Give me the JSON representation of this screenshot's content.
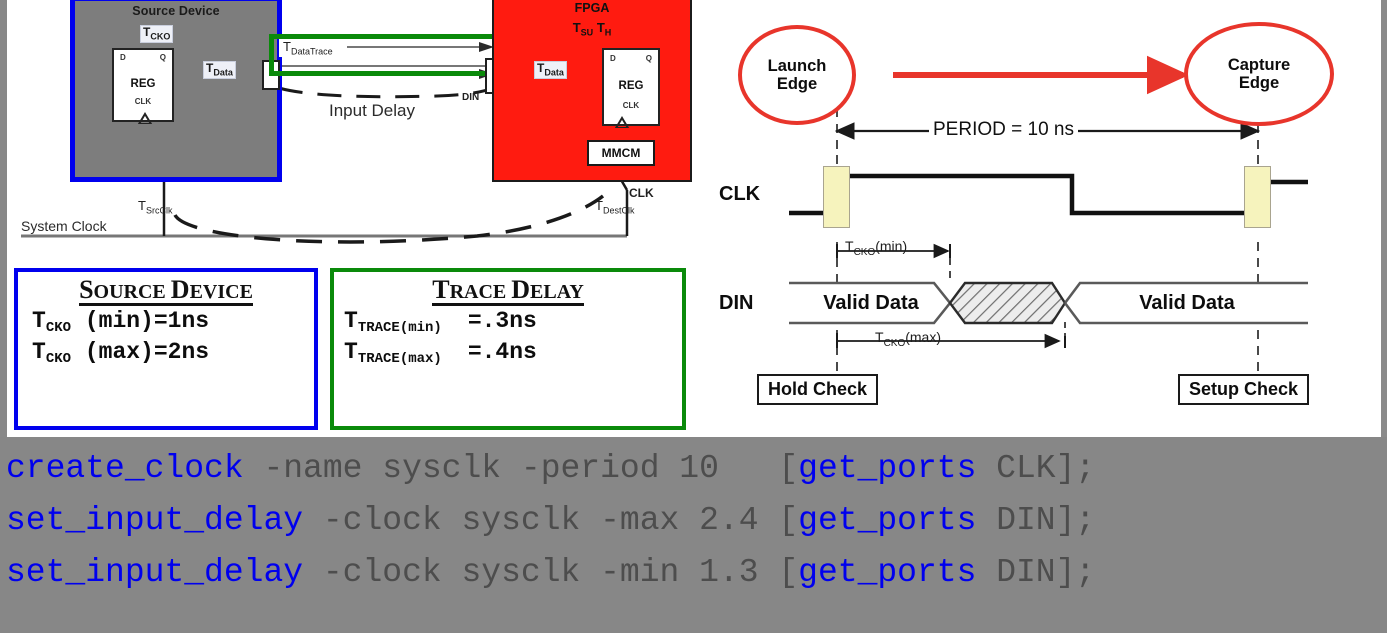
{
  "block_diagram": {
    "source_device": {
      "title": "Source Device",
      "tcko_badge": "T",
      "tcko_badge_sub": "CKO",
      "reg_name": "REG",
      "pin_d": "D",
      "pin_q": "Q",
      "pin_clk": "CLK",
      "tdata_badge": "T",
      "tdata_badge_sub": "Data"
    },
    "fpga": {
      "title": "FPGA",
      "subtitle_tsu": "T",
      "subtitle_tsu_sub": "SU",
      "subtitle_th": "T",
      "subtitle_th_sub": "H",
      "reg_name": "REG",
      "pin_d": "D",
      "pin_q": "Q",
      "pin_clk": "CLK",
      "tdata_badge": "T",
      "tdata_badge_sub": "Data",
      "mmcm": "MMCM",
      "clk_label": "CLK"
    },
    "trace": {
      "tdatatrace": "T",
      "tdatatrace_sub": "DataTrace",
      "din_label": "DIN",
      "input_delay": "Input Delay"
    },
    "clocking": {
      "system_clock": "System Clock",
      "tsrcclk": "T",
      "tsrcclk_sub": "SrcClk",
      "tdestclk": "T",
      "tdestclk_sub": "DestClk"
    }
  },
  "legends": {
    "source_device": {
      "title_first": "S",
      "title_rest": "OURCE ",
      "title_first2": "D",
      "title_rest2": "EVICE",
      "rows": [
        {
          "sym": "T",
          "sub": "CKO",
          "expr": " (min)=1ns"
        },
        {
          "sym": "T",
          "sub": "CKO",
          "expr": " (max)=2ns"
        }
      ]
    },
    "trace_delay": {
      "title_first": "T",
      "title_rest": "RACE ",
      "title_first2": "D",
      "title_rest2": "ELAY",
      "rows": [
        {
          "sym": "T",
          "sub": "TRACE(min)",
          "expr": "=.3ns"
        },
        {
          "sym": "T",
          "sub": "TRACE(max)",
          "expr": "=.4ns"
        }
      ]
    }
  },
  "timing": {
    "launch_edge": "Launch\nEdge",
    "launch_edge_line1": "Launch",
    "launch_edge_line2": "Edge",
    "capture_edge_line1": "Capture",
    "capture_edge_line2": "Edge",
    "period_label": "PERIOD = 10 ns",
    "clk_label": "CLK",
    "din_label": "DIN",
    "valid_data_left": "Valid Data",
    "valid_data_right": "Valid Data",
    "tcko_min": "T",
    "tcko_min_sub": "CKO",
    "tcko_min_tail": "(min)",
    "tcko_max": "T",
    "tcko_max_sub": "CKO",
    "tcko_max_tail": "(max)",
    "hold_check": "Hold Check",
    "setup_check": "Setup Check"
  },
  "code": {
    "lines": [
      {
        "kw1": "create_clock",
        "arg1": " -name sysclk -period 10   ",
        "kw2": "[get_ports",
        "arg2": " CLK];"
      },
      {
        "kw1": "set_input_delay",
        "arg1": " -clock sysclk -max 2.4 ",
        "kw2": "[get_ports",
        "arg2": " DIN];"
      },
      {
        "kw1": "set_input_delay",
        "arg1": " -clock sysclk -min 1.3 ",
        "kw2": "[get_ports",
        "arg2": " DIN];"
      }
    ],
    "raw": [
      "create_clock -name sysclk -period 10   [get_ports CLK];",
      "set_input_delay -clock sysclk -max 2.4 [get_ports DIN];",
      "set_input_delay -clock sysclk -min 1.3 [get_ports DIN];"
    ]
  },
  "colors": {
    "source_border": "#0000ee",
    "trace_border": "#0a8a0a",
    "fpga_fill": "#ff1b10",
    "source_fill": "#7d7d7d",
    "code_bg": "#878787",
    "code_keyword": "#0000ee",
    "code_arg": "#4d4d4d",
    "edge_ellipse": "#e8352b",
    "clk_highlight": "#f6f3bd"
  }
}
